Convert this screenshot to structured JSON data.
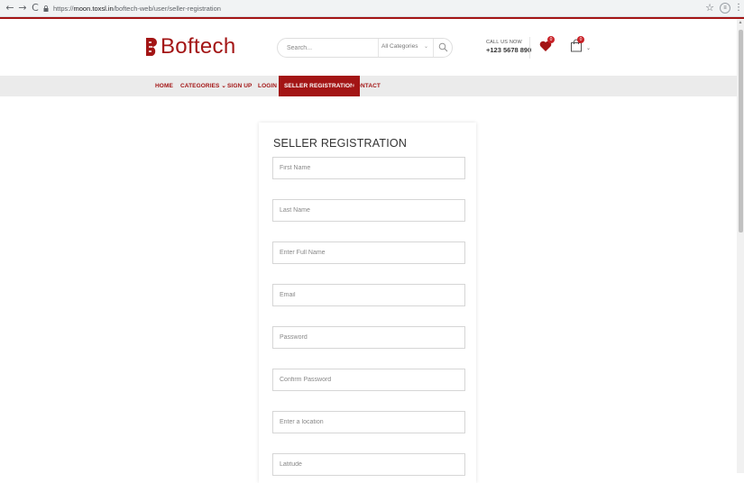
{
  "browser": {
    "back": "←",
    "forward": "→",
    "reload": "C",
    "url_prefix": "https://",
    "url_domain": "moon.toxsl.in",
    "url_path": "/boftech-web/user/seller-registration",
    "star": "☆",
    "menu": "⋮",
    "ext": "≡"
  },
  "header": {
    "logo_text": "Boftech",
    "search_placeholder": "Search...",
    "category_selected": "All Categories",
    "call_label": "CALL US NOW",
    "call_number": "+123 5678 890",
    "wishlist_count": "0",
    "cart_count": "0"
  },
  "nav": {
    "items": [
      {
        "label": "HOME"
      },
      {
        "label": "CATEGORIES ⌄"
      },
      {
        "label": "SIGN UP"
      },
      {
        "label": "LOGIN"
      },
      {
        "label": "SELLER REGISTRATION"
      },
      {
        "label": "CONTACT"
      }
    ]
  },
  "form": {
    "title": "SELLER REGISTRATION",
    "fields": [
      {
        "placeholder": "First Name"
      },
      {
        "placeholder": "Last Name"
      },
      {
        "placeholder": "Enter Full Name"
      },
      {
        "placeholder": "Email"
      },
      {
        "placeholder": "Password"
      },
      {
        "placeholder": "Confirm Password"
      },
      {
        "placeholder": "Enter a location"
      },
      {
        "placeholder": "Latitude"
      }
    ]
  },
  "colors": {
    "brand": "#a31515",
    "nav_bg": "#ebebeb",
    "badge": "#c92127"
  }
}
